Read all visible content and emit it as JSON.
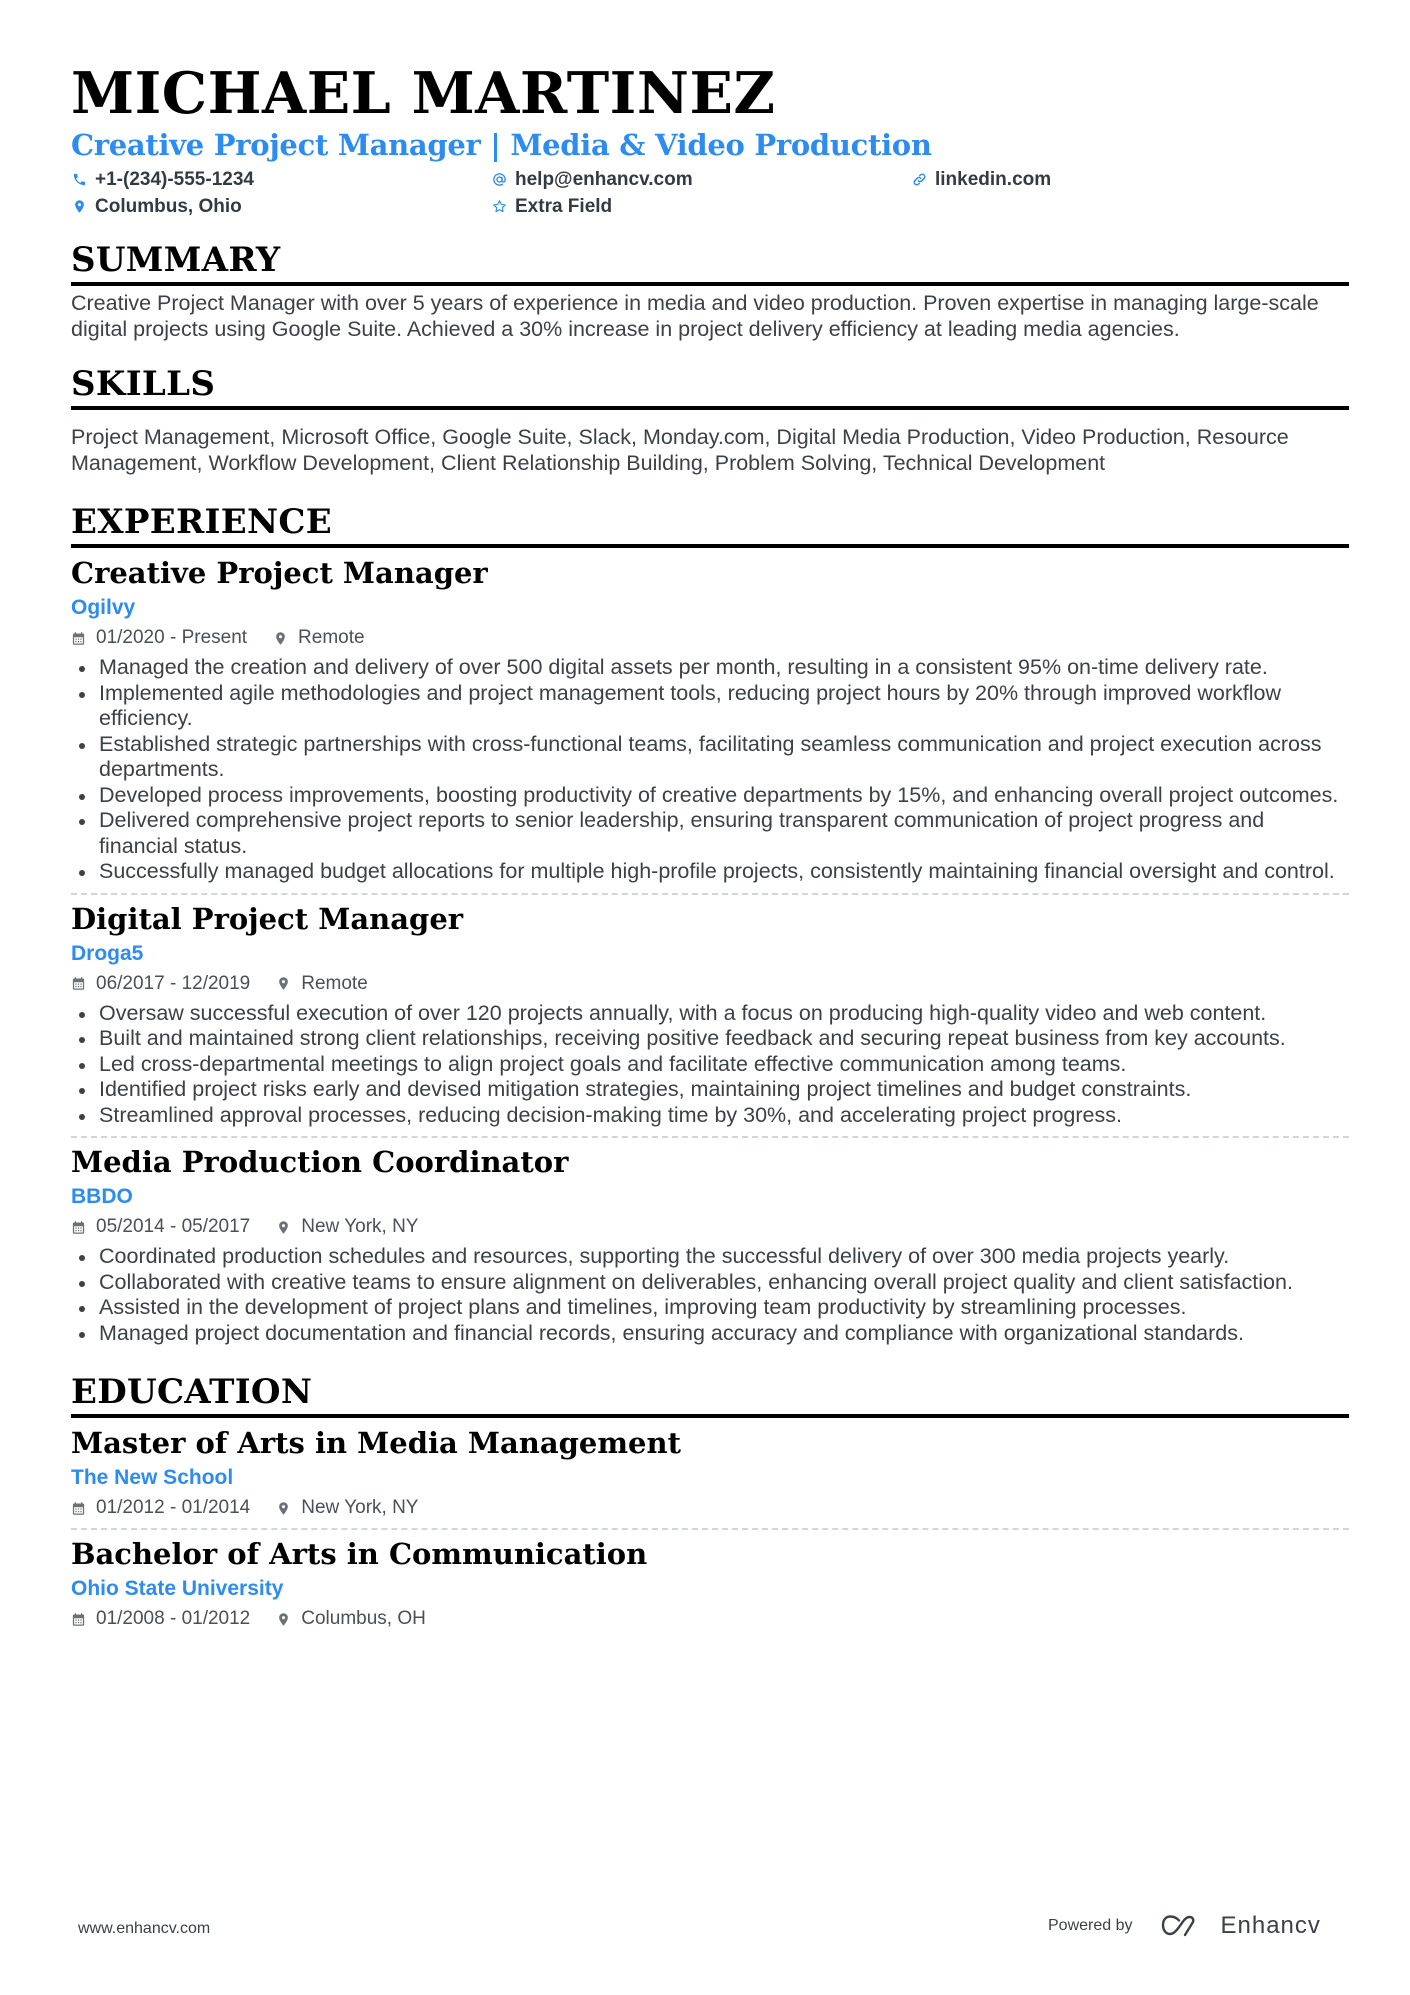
{
  "header": {
    "name": "MICHAEL MARTINEZ",
    "headline": "Creative Project Manager | Media & Video Production",
    "contacts": [
      {
        "icon": "phone-icon",
        "text": "+1-(234)-555-1234"
      },
      {
        "icon": "at-icon",
        "text": "help@enhancv.com"
      },
      {
        "icon": "link-icon",
        "text": "linkedin.com"
      },
      {
        "icon": "location-pin-icon",
        "text": "Columbus, Ohio"
      },
      {
        "icon": "star-icon",
        "text": "Extra Field"
      }
    ]
  },
  "summary": {
    "title": "SUMMARY",
    "text": "Creative Project Manager with over 5 years of experience in media and video production. Proven expertise in managing large-scale digital projects using Google Suite. Achieved a 30% increase in project delivery efficiency at leading media agencies."
  },
  "skills": {
    "title": "SKILLS",
    "text": "Project Management, Microsoft Office, Google Suite, Slack, Monday.com, Digital Media Production, Video Production, Resource Management, Workflow Development, Client Relationship Building, Problem Solving, Technical Development"
  },
  "experience": {
    "title": "EXPERIENCE",
    "items": [
      {
        "role": "Creative Project Manager",
        "company": "Ogilvy",
        "dates": "01/2020 - Present",
        "location": "Remote",
        "bullets": [
          "Managed the creation and delivery of over 500 digital assets per month, resulting in a consistent 95% on-time delivery rate.",
          "Implemented agile methodologies and project management tools, reducing project hours by 20% through improved workflow efficiency.",
          "Established strategic partnerships with cross-functional teams, facilitating seamless communication and project execution across departments.",
          "Developed process improvements, boosting productivity of creative departments by 15%, and enhancing overall project outcomes.",
          "Delivered comprehensive project reports to senior leadership, ensuring transparent communication of project progress and financial status.",
          "Successfully managed budget allocations for multiple high-profile projects, consistently maintaining financial oversight and control."
        ]
      },
      {
        "role": "Digital Project Manager",
        "company": "Droga5",
        "dates": "06/2017 - 12/2019",
        "location": "Remote",
        "bullets": [
          "Oversaw successful execution of over 120 projects annually, with a focus on producing high-quality video and web content.",
          "Built and maintained strong client relationships, receiving positive feedback and securing repeat business from key accounts.",
          "Led cross-departmental meetings to align project goals and facilitate effective communication among teams.",
          "Identified project risks early and devised mitigation strategies, maintaining project timelines and budget constraints.",
          "Streamlined approval processes, reducing decision-making time by 30%, and accelerating project progress."
        ]
      },
      {
        "role": "Media Production Coordinator",
        "company": "BBDO",
        "dates": "05/2014 - 05/2017",
        "location": "New York, NY",
        "bullets": [
          "Coordinated production schedules and resources, supporting the successful delivery of over 300 media projects yearly.",
          "Collaborated with creative teams to ensure alignment on deliverables, enhancing overall project quality and client satisfaction.",
          "Assisted in the development of project plans and timelines, improving team productivity by streamlining processes.",
          "Managed project documentation and financial records, ensuring accuracy and compliance with organizational standards."
        ]
      }
    ]
  },
  "education": {
    "title": "EDUCATION",
    "items": [
      {
        "degree": "Master of Arts in Media Management",
        "school": "The New School",
        "dates": "01/2012 - 01/2014",
        "location": "New York, NY"
      },
      {
        "degree": "Bachelor of Arts in Communication",
        "school": "Ohio State University",
        "dates": "01/2008 - 01/2012",
        "location": "Columbus, OH"
      }
    ]
  },
  "footer": {
    "website": "www.enhancv.com",
    "powered_by": "Powered by",
    "brand": "Enhancv"
  },
  "colors": {
    "accent": "#2d8cf0",
    "text": "#3b4147",
    "heading": "#000000"
  }
}
